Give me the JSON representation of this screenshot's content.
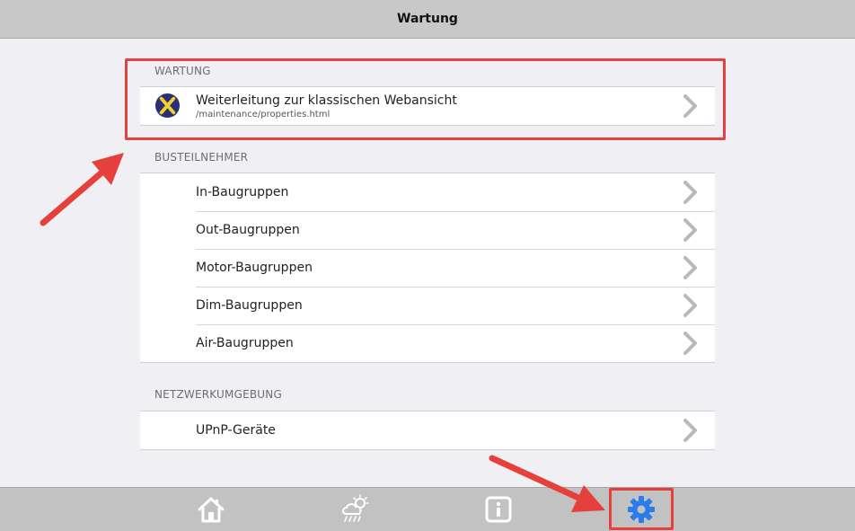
{
  "header": {
    "title": "Wartung"
  },
  "sections": [
    {
      "header": "WARTUNG",
      "items": [
        {
          "label": "Weiterleitung zur klassischen Webansicht",
          "sublabel": "/maintenance/properties.html"
        }
      ]
    },
    {
      "header": "BUSTEILNEHMER",
      "items": [
        {
          "label": "In-Baugruppen"
        },
        {
          "label": "Out-Baugruppen"
        },
        {
          "label": "Motor-Baugruppen"
        },
        {
          "label": "Dim-Baugruppen"
        },
        {
          "label": "Air-Baugruppen"
        }
      ]
    },
    {
      "header": "NETZWERKUMGEBUNG",
      "items": [
        {
          "label": "UPnP-Geräte"
        }
      ]
    }
  ],
  "tabbar": {
    "items": [
      {
        "icon": "home-icon"
      },
      {
        "icon": "weather-icon"
      },
      {
        "icon": "info-icon"
      },
      {
        "icon": "gear-icon",
        "active": true
      }
    ]
  },
  "colors": {
    "accent": "#2b7de9",
    "annotation": "#e5403b",
    "title_bar": "#c8c8c8",
    "tab_bar": "#c2c2c2",
    "background": "#efeff4"
  }
}
